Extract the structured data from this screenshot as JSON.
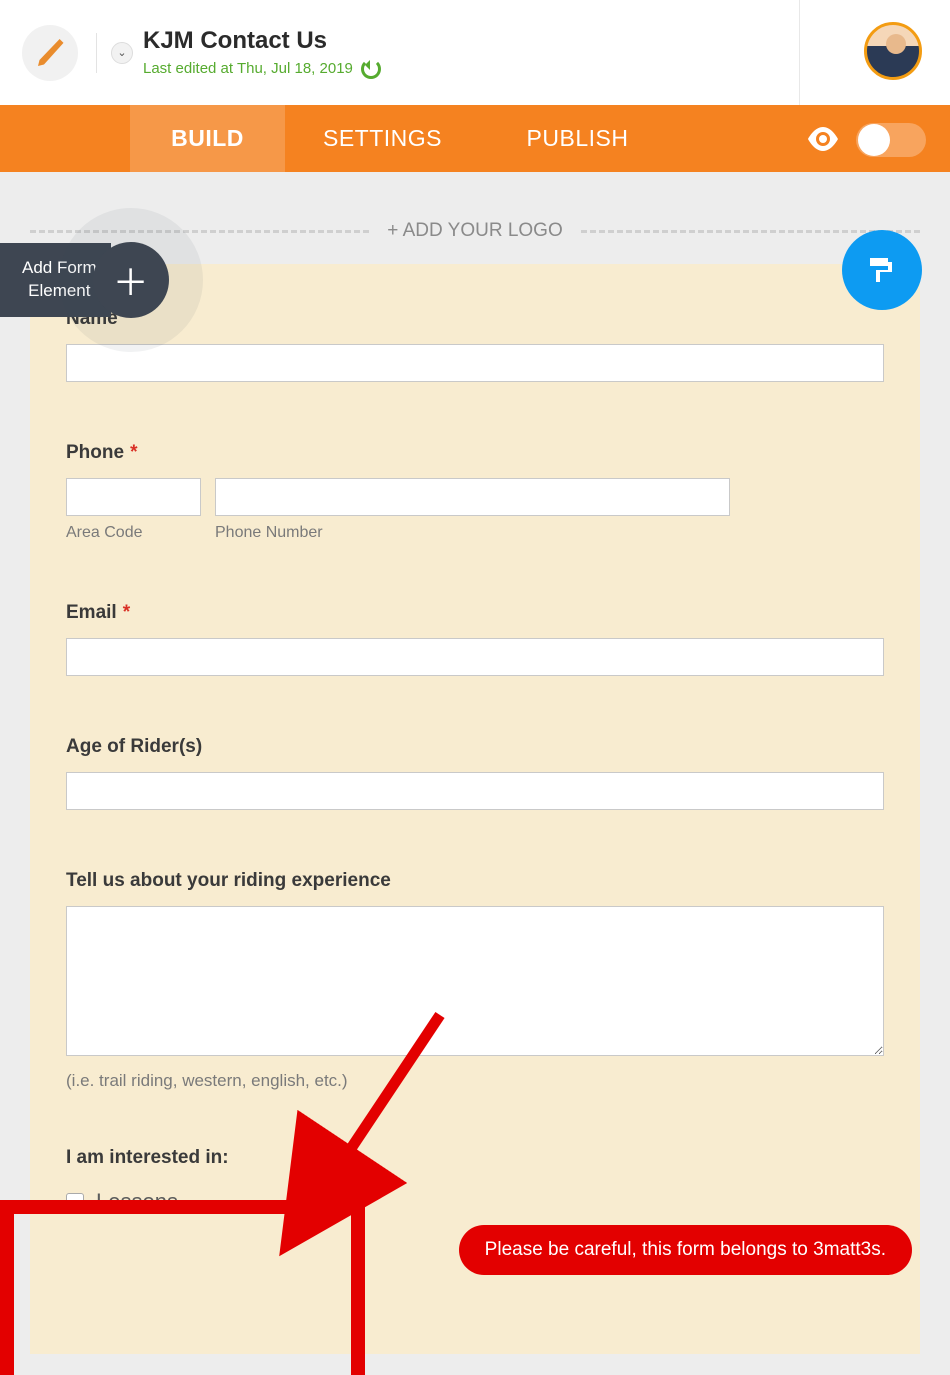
{
  "header": {
    "form_title": "KJM Contact Us",
    "last_edited": "Last edited at Thu, Jul 18, 2019"
  },
  "tabs": {
    "build": "BUILD",
    "settings": "SETTINGS",
    "publish": "PUBLISH"
  },
  "canvas": {
    "add_logo": "+ ADD YOUR LOGO",
    "add_element_line1": "Add Form",
    "add_element_line2": "Element"
  },
  "form": {
    "name_label": "Name",
    "phone_label": "Phone",
    "area_code_sub": "Area Code",
    "phone_number_sub": "Phone Number",
    "email_label": "Email",
    "age_label": "Age of Rider(s)",
    "experience_label": "Tell us about your riding experience",
    "experience_hint": "(i.e. trail riding, western, english, etc.)",
    "interested_label": "I am interested in:",
    "option_lessons": "Lessons"
  },
  "warning": "Please be careful, this form belongs to 3matt3s."
}
